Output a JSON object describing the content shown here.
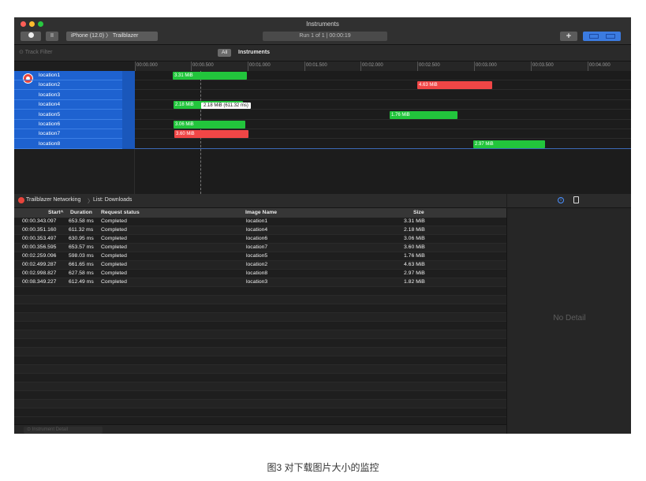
{
  "window": {
    "title": "Instruments",
    "colors": {
      "accent": "#1e62d0",
      "green_bar": "#22c53c",
      "red_bar": "#f04646"
    }
  },
  "toolbar": {
    "target": "iPhone (12.0) 〉 Trailblazer",
    "run_status": "Run 1 of 1  |  00:00:19",
    "add_label": "+",
    "pause_label": "II"
  },
  "filter": {
    "placeholder": "Track Filter",
    "all_label": "All",
    "instruments_label": "Instruments"
  },
  "ruler": {
    "ticks": [
      "00:00.000",
      "00:00.500",
      "00:01.000",
      "00:01.500",
      "00:02.000",
      "00:02.500",
      "00:03.000",
      "00:03.500",
      "00:04.000"
    ]
  },
  "tracks": {
    "locations": [
      "location1",
      "location2",
      "location3",
      "location4",
      "location5",
      "location6",
      "location7",
      "location8"
    ],
    "bar_labels": {
      "location1": "3.31 MiB",
      "location2": "4.63 MiB",
      "location4": "2.18 MiB",
      "location5": "1.76 MiB",
      "location6": "3.06 MiB",
      "location7": "3.60 MiB",
      "location8": "2.97 MiB"
    },
    "tooltip": "2.18 MiB (611.32 ms)"
  },
  "detail": {
    "instrument": "Trailblazer Networking",
    "list": "List: Downloads",
    "columns": [
      "Start^",
      "Duration",
      "Request status",
      "Image Name",
      "Size"
    ],
    "rows": [
      [
        "00:00.343.097",
        "653.58 ms",
        "Completed",
        "location1",
        "3.31 MiB"
      ],
      [
        "00:00.351.160",
        "611.32 ms",
        "Completed",
        "location4",
        "2.18 MiB"
      ],
      [
        "00:00.353.497",
        "630.95 ms",
        "Completed",
        "location6",
        "3.06 MiB"
      ],
      [
        "00:00.356.595",
        "653.57 ms",
        "Completed",
        "location7",
        "3.60 MiB"
      ],
      [
        "00:02.259.096",
        "598.03 ms",
        "Completed",
        "location5",
        "1.76 MiB"
      ],
      [
        "00:02.499.287",
        "661.65 ms",
        "Completed",
        "location2",
        "4.63 MiB"
      ],
      [
        "00:02.998.827",
        "627.58 ms",
        "Completed",
        "location8",
        "2.97 MiB"
      ],
      [
        "00:08.349.227",
        "612.49 ms",
        "Completed",
        "location3",
        "1.82 MiB"
      ]
    ],
    "no_detail": "No Detail",
    "footer_field": "Instrument Detail"
  },
  "caption": "图3 对下载图片大小的监控"
}
